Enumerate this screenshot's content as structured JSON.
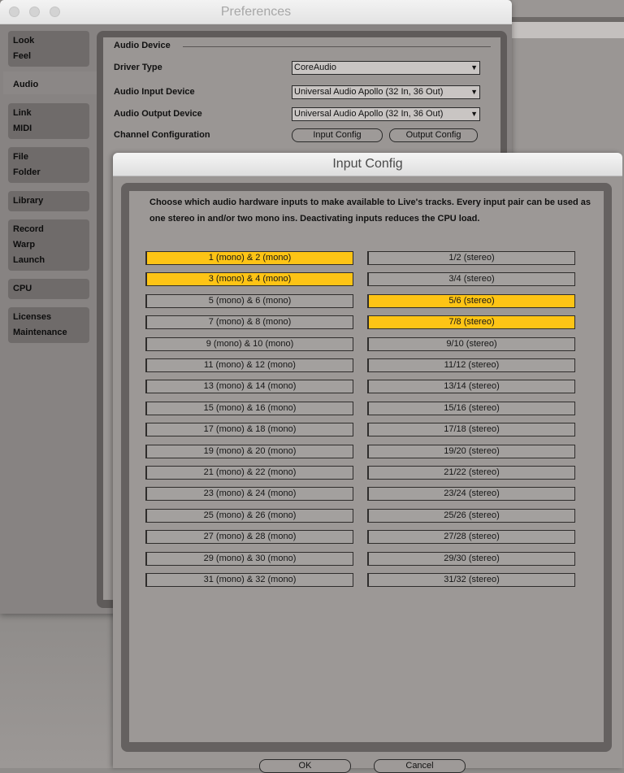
{
  "preferences_window": {
    "title": "Preferences",
    "sidebar": [
      {
        "items": [
          "Look",
          "Feel"
        ]
      },
      {
        "items": [
          "Audio"
        ],
        "active": true
      },
      {
        "items": [
          "Link",
          "MIDI"
        ]
      },
      {
        "items": [
          "File",
          "Folder"
        ]
      },
      {
        "items": [
          "Library"
        ]
      },
      {
        "items": [
          "Record",
          "Warp",
          "Launch"
        ]
      },
      {
        "items": [
          "CPU"
        ]
      },
      {
        "items": [
          "Licenses",
          "Maintenance"
        ]
      }
    ],
    "audio_device": {
      "section_title": "Audio Device",
      "driver_type_label": "Driver Type",
      "driver_type_value": "CoreAudio",
      "input_device_label": "Audio Input Device",
      "input_device_value": "Universal Audio Apollo (32 In, 36 Out)",
      "output_device_label": "Audio Output Device",
      "output_device_value": "Universal Audio Apollo (32 In, 36 Out)",
      "channel_config_label": "Channel Configuration",
      "input_config_button": "Input Config",
      "output_config_button": "Output Config",
      "dropdown_arrow": "▼"
    }
  },
  "input_config_dialog": {
    "title": "Input Config",
    "description": "Choose which audio hardware inputs to make available to Live's tracks. Every input pair can be used as one stereo in and/or two mono ins.  Deactivating inputs reduces the CPU load.",
    "accent_color": "#fdc415",
    "mono_pairs": [
      {
        "label": "1 (mono) & 2 (mono)",
        "active": true
      },
      {
        "label": "3 (mono) & 4 (mono)",
        "active": true
      },
      {
        "label": "5 (mono) & 6 (mono)",
        "active": false
      },
      {
        "label": "7 (mono) & 8 (mono)",
        "active": false
      },
      {
        "label": "9 (mono) & 10 (mono)",
        "active": false
      },
      {
        "label": "11 (mono) & 12 (mono)",
        "active": false
      },
      {
        "label": "13 (mono) & 14 (mono)",
        "active": false
      },
      {
        "label": "15 (mono) & 16 (mono)",
        "active": false
      },
      {
        "label": "17 (mono) & 18 (mono)",
        "active": false
      },
      {
        "label": "19 (mono) & 20 (mono)",
        "active": false
      },
      {
        "label": "21 (mono) & 22 (mono)",
        "active": false
      },
      {
        "label": "23 (mono) & 24 (mono)",
        "active": false
      },
      {
        "label": "25 (mono) & 26 (mono)",
        "active": false
      },
      {
        "label": "27 (mono) & 28 (mono)",
        "active": false
      },
      {
        "label": "29 (mono) & 30 (mono)",
        "active": false
      },
      {
        "label": "31 (mono) & 32 (mono)",
        "active": false
      }
    ],
    "stereo_pairs": [
      {
        "label": "1/2 (stereo)",
        "active": false
      },
      {
        "label": "3/4 (stereo)",
        "active": false
      },
      {
        "label": "5/6 (stereo)",
        "active": true
      },
      {
        "label": "7/8 (stereo)",
        "active": true
      },
      {
        "label": "9/10 (stereo)",
        "active": false
      },
      {
        "label": "11/12 (stereo)",
        "active": false
      },
      {
        "label": "13/14 (stereo)",
        "active": false
      },
      {
        "label": "15/16 (stereo)",
        "active": false
      },
      {
        "label": "17/18 (stereo)",
        "active": false
      },
      {
        "label": "19/20 (stereo)",
        "active": false
      },
      {
        "label": "21/22 (stereo)",
        "active": false
      },
      {
        "label": "23/24 (stereo)",
        "active": false
      },
      {
        "label": "25/26 (stereo)",
        "active": false
      },
      {
        "label": "27/28 (stereo)",
        "active": false
      },
      {
        "label": "29/30 (stereo)",
        "active": false
      },
      {
        "label": "31/32 (stereo)",
        "active": false
      }
    ],
    "ok_button": "OK",
    "cancel_button": "Cancel"
  }
}
